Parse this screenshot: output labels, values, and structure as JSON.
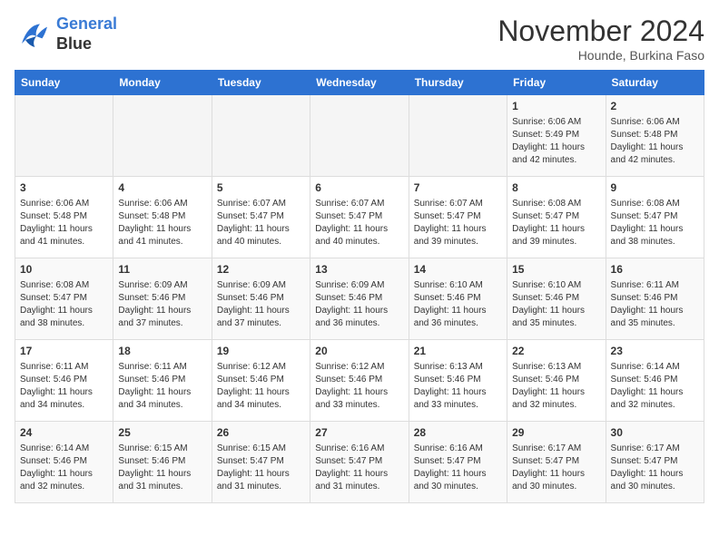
{
  "header": {
    "logo_line1": "General",
    "logo_line2": "Blue",
    "month": "November 2024",
    "location": "Hounde, Burkina Faso"
  },
  "days_of_week": [
    "Sunday",
    "Monday",
    "Tuesday",
    "Wednesday",
    "Thursday",
    "Friday",
    "Saturday"
  ],
  "weeks": [
    [
      {
        "day": "",
        "info": ""
      },
      {
        "day": "",
        "info": ""
      },
      {
        "day": "",
        "info": ""
      },
      {
        "day": "",
        "info": ""
      },
      {
        "day": "",
        "info": ""
      },
      {
        "day": "1",
        "info": "Sunrise: 6:06 AM\nSunset: 5:49 PM\nDaylight: 11 hours and 42 minutes."
      },
      {
        "day": "2",
        "info": "Sunrise: 6:06 AM\nSunset: 5:48 PM\nDaylight: 11 hours and 42 minutes."
      }
    ],
    [
      {
        "day": "3",
        "info": "Sunrise: 6:06 AM\nSunset: 5:48 PM\nDaylight: 11 hours and 41 minutes."
      },
      {
        "day": "4",
        "info": "Sunrise: 6:06 AM\nSunset: 5:48 PM\nDaylight: 11 hours and 41 minutes."
      },
      {
        "day": "5",
        "info": "Sunrise: 6:07 AM\nSunset: 5:47 PM\nDaylight: 11 hours and 40 minutes."
      },
      {
        "day": "6",
        "info": "Sunrise: 6:07 AM\nSunset: 5:47 PM\nDaylight: 11 hours and 40 minutes."
      },
      {
        "day": "7",
        "info": "Sunrise: 6:07 AM\nSunset: 5:47 PM\nDaylight: 11 hours and 39 minutes."
      },
      {
        "day": "8",
        "info": "Sunrise: 6:08 AM\nSunset: 5:47 PM\nDaylight: 11 hours and 39 minutes."
      },
      {
        "day": "9",
        "info": "Sunrise: 6:08 AM\nSunset: 5:47 PM\nDaylight: 11 hours and 38 minutes."
      }
    ],
    [
      {
        "day": "10",
        "info": "Sunrise: 6:08 AM\nSunset: 5:47 PM\nDaylight: 11 hours and 38 minutes."
      },
      {
        "day": "11",
        "info": "Sunrise: 6:09 AM\nSunset: 5:46 PM\nDaylight: 11 hours and 37 minutes."
      },
      {
        "day": "12",
        "info": "Sunrise: 6:09 AM\nSunset: 5:46 PM\nDaylight: 11 hours and 37 minutes."
      },
      {
        "day": "13",
        "info": "Sunrise: 6:09 AM\nSunset: 5:46 PM\nDaylight: 11 hours and 36 minutes."
      },
      {
        "day": "14",
        "info": "Sunrise: 6:10 AM\nSunset: 5:46 PM\nDaylight: 11 hours and 36 minutes."
      },
      {
        "day": "15",
        "info": "Sunrise: 6:10 AM\nSunset: 5:46 PM\nDaylight: 11 hours and 35 minutes."
      },
      {
        "day": "16",
        "info": "Sunrise: 6:11 AM\nSunset: 5:46 PM\nDaylight: 11 hours and 35 minutes."
      }
    ],
    [
      {
        "day": "17",
        "info": "Sunrise: 6:11 AM\nSunset: 5:46 PM\nDaylight: 11 hours and 34 minutes."
      },
      {
        "day": "18",
        "info": "Sunrise: 6:11 AM\nSunset: 5:46 PM\nDaylight: 11 hours and 34 minutes."
      },
      {
        "day": "19",
        "info": "Sunrise: 6:12 AM\nSunset: 5:46 PM\nDaylight: 11 hours and 34 minutes."
      },
      {
        "day": "20",
        "info": "Sunrise: 6:12 AM\nSunset: 5:46 PM\nDaylight: 11 hours and 33 minutes."
      },
      {
        "day": "21",
        "info": "Sunrise: 6:13 AM\nSunset: 5:46 PM\nDaylight: 11 hours and 33 minutes."
      },
      {
        "day": "22",
        "info": "Sunrise: 6:13 AM\nSunset: 5:46 PM\nDaylight: 11 hours and 32 minutes."
      },
      {
        "day": "23",
        "info": "Sunrise: 6:14 AM\nSunset: 5:46 PM\nDaylight: 11 hours and 32 minutes."
      }
    ],
    [
      {
        "day": "24",
        "info": "Sunrise: 6:14 AM\nSunset: 5:46 PM\nDaylight: 11 hours and 32 minutes."
      },
      {
        "day": "25",
        "info": "Sunrise: 6:15 AM\nSunset: 5:46 PM\nDaylight: 11 hours and 31 minutes."
      },
      {
        "day": "26",
        "info": "Sunrise: 6:15 AM\nSunset: 5:47 PM\nDaylight: 11 hours and 31 minutes."
      },
      {
        "day": "27",
        "info": "Sunrise: 6:16 AM\nSunset: 5:47 PM\nDaylight: 11 hours and 31 minutes."
      },
      {
        "day": "28",
        "info": "Sunrise: 6:16 AM\nSunset: 5:47 PM\nDaylight: 11 hours and 30 minutes."
      },
      {
        "day": "29",
        "info": "Sunrise: 6:17 AM\nSunset: 5:47 PM\nDaylight: 11 hours and 30 minutes."
      },
      {
        "day": "30",
        "info": "Sunrise: 6:17 AM\nSunset: 5:47 PM\nDaylight: 11 hours and 30 minutes."
      }
    ]
  ]
}
